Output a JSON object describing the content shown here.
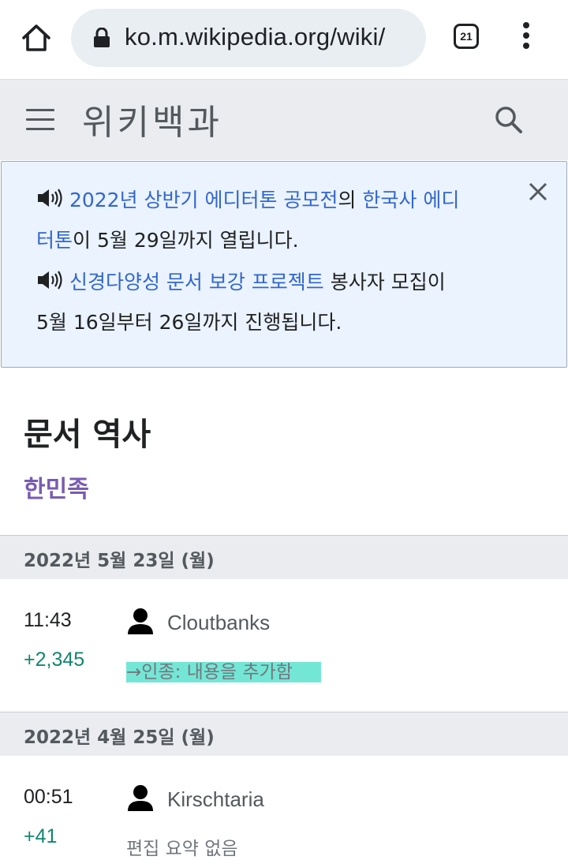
{
  "browser": {
    "url": "ko.m.wikipedia.org/wiki/",
    "tab_count": "21"
  },
  "header": {
    "site_title": "위키백과"
  },
  "notice": {
    "line1_link1": "2022년 상반기 에디터톤 공모전",
    "line1_text": "의 ",
    "line1_link2": "한국사 에디",
    "line2_link": "터톤",
    "line2_text": "이 5월 29일까지 열립니다.",
    "line3_link": "신경다양성 문서 보강 프로젝트",
    "line3_text": " 봉사자 모집이",
    "line4_text": "5월 16일부터 26일까지 진행됩니다."
  },
  "page": {
    "heading": "문서 역사",
    "article_link": "한민족"
  },
  "history": [
    {
      "date": "2022년 5월 23일 (월)",
      "time": "11:43",
      "diff": "+2,345",
      "user": "Cloutbanks",
      "summary": "→인종: 내용을 추가함"
    },
    {
      "date": "2022년 4월 25일 (월)",
      "time": "00:51",
      "diff": "+41",
      "user": "Kirschtaria",
      "summary": "편집 요약 없음"
    }
  ],
  "colors": {
    "link": "#3366cc",
    "visited_link": "#795cb2",
    "diff_positive": "#14866d",
    "highlight": "#74e6d6"
  }
}
